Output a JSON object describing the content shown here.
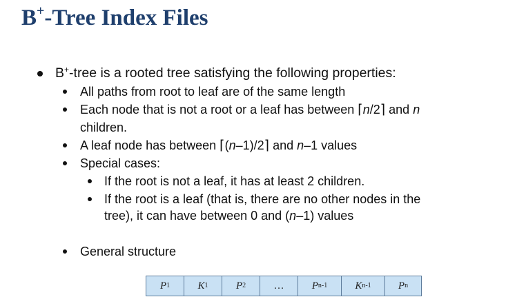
{
  "slide": {
    "title": {
      "main": "B",
      "sup": "+",
      "rest": "-Tree Index Files"
    },
    "intro": {
      "main": "B",
      "sup": "+",
      "rest": "-tree is a rooted tree satisfying the following properties:"
    },
    "props": {
      "p1": "All paths from root to leaf are of the same length",
      "p2a": "Each node that is not a root or a leaf has between ",
      "p2_ceil_left": "⌈",
      "p2_n_over": "n",
      "p2_over_2": "/2",
      "p2_ceil_right": "⌉",
      "p2_and": " and ",
      "p2_n": "n",
      "p2b": "children.",
      "p3a": "A leaf node has between ",
      "p3_ceil_left": "⌈",
      "p3_paren": "(",
      "p3_n": "n",
      "p3_expr": "–1)/2",
      "p3_ceil_right": "⌉",
      "p3_and": " and ",
      "p3_n2": "n",
      "p3_tail": "–1 values",
      "p4": "Special cases:"
    },
    "special": {
      "s1": "If the root is not a leaf, it has at least 2 children.",
      "s2a": "If the root is a leaf (that is, there are no other nodes in the",
      "s2b_pre": "tree), it can have between 0 and (",
      "s2b_n": "n",
      "s2b_post": "–1) values"
    },
    "general": "General structure",
    "node_cells": [
      {
        "base": "P",
        "sub": "1"
      },
      {
        "base": "K",
        "sub": "1"
      },
      {
        "base": "P",
        "sub": "2"
      },
      {
        "base": "…",
        "sub": ""
      },
      {
        "base": "P",
        "sub": "n-1"
      },
      {
        "base": "K",
        "sub": "n-1"
      },
      {
        "base": "P",
        "sub": "n"
      }
    ],
    "colors": {
      "title": "#1f3f6d",
      "cell_fill": "#c9e1f4",
      "cell_border": "#5b7a9a"
    }
  }
}
